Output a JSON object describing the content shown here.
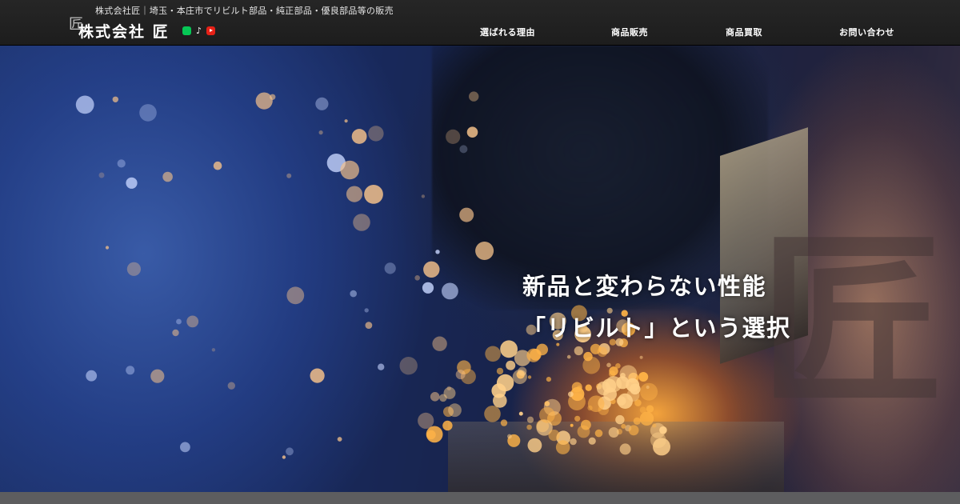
{
  "header": {
    "tagline": "株式会社匠｜埼玉・本庄市でリビルト部品・純正部品・優良部品等の販売",
    "logo_mark": "匠",
    "logo_text": "株式会社 匠",
    "sns": [
      {
        "name": "line-icon"
      },
      {
        "name": "tiktok-icon",
        "glyph": "♪"
      },
      {
        "name": "youtube-icon"
      }
    ],
    "nav": [
      {
        "label": "選ばれる理由"
      },
      {
        "label": "商品販売"
      },
      {
        "label": "商品買取"
      },
      {
        "label": "お問い合わせ"
      }
    ]
  },
  "hero": {
    "catch_line1": "新品と変わらない性能",
    "catch_line2": "「リビルト」という選択",
    "watermark": "匠"
  },
  "colors": {
    "header_bg": "#222222",
    "line_green": "#06c755",
    "youtube_red": "#e62117",
    "spark_orange": "#ffb347"
  }
}
